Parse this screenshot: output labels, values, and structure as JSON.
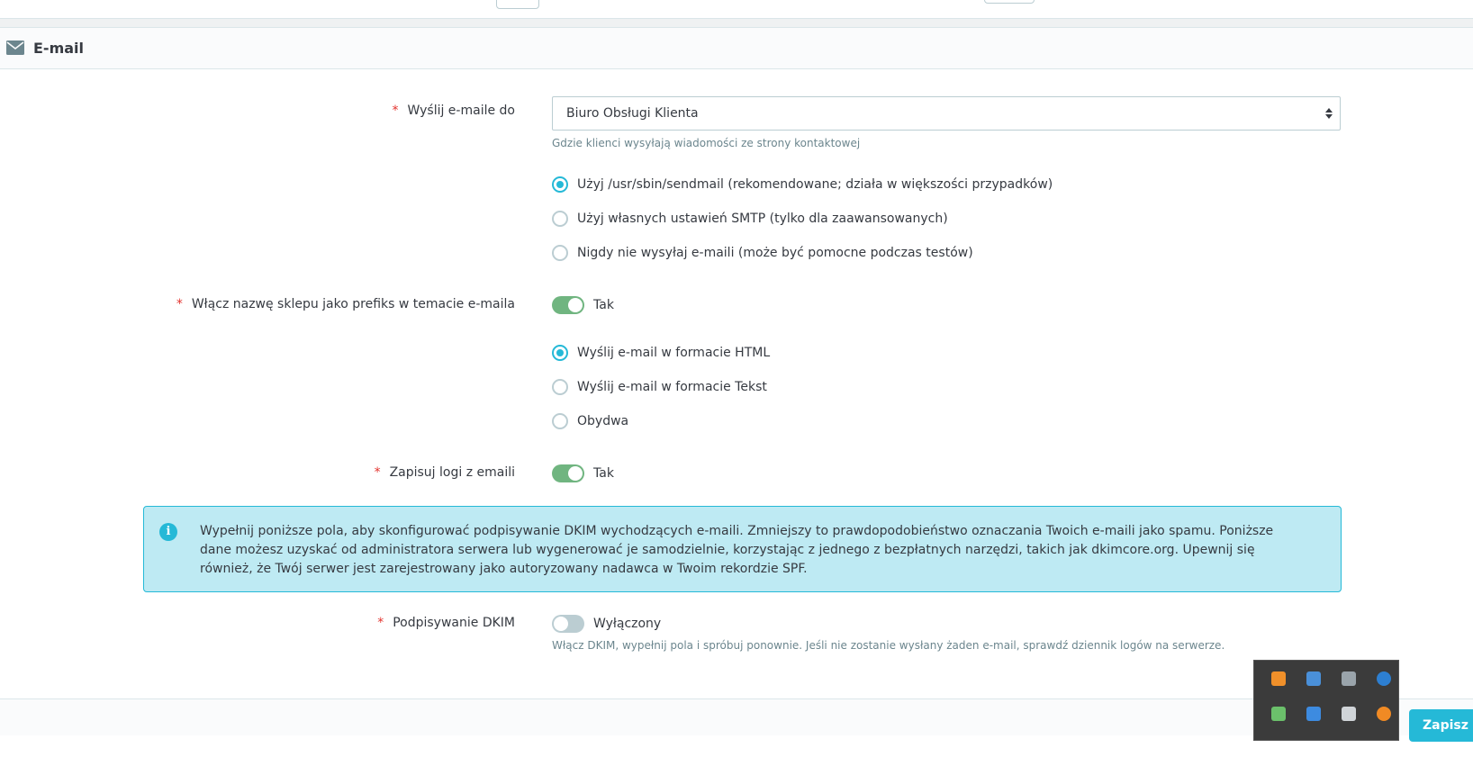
{
  "panel": {
    "title": "E-mail",
    "icon": "envelope-icon"
  },
  "fields": {
    "send_to": {
      "label": "Wyślij e-maile do",
      "required_mark": "*",
      "selected_value": "Biuro Obsługi Klienta",
      "help": "Gdzie klienci wysyłają wiadomości ze strony kontaktowej"
    },
    "mail_method": {
      "options": [
        {
          "label": "Użyj /usr/sbin/sendmail (rekomendowane; działa w większości przypadków)",
          "checked": true
        },
        {
          "label": "Użyj własnych ustawień SMTP (tylko dla zaawansowanych)",
          "checked": false
        },
        {
          "label": "Nigdy nie wysyłaj e-maili (może być pomocne podczas testów)",
          "checked": false
        }
      ]
    },
    "shop_prefix": {
      "label": "Włącz nazwę sklepu jako prefiks w temacie e-maila",
      "required_mark": "*",
      "state": "Tak",
      "enabled": true
    },
    "mail_format": {
      "options": [
        {
          "label": "Wyślij e-mail w formacie HTML",
          "checked": true
        },
        {
          "label": "Wyślij e-mail w formacie Tekst",
          "checked": false
        },
        {
          "label": "Obydwa",
          "checked": false
        }
      ]
    },
    "log_emails": {
      "label": "Zapisuj logi z emaili",
      "required_mark": "*",
      "state": "Tak",
      "enabled": true
    },
    "dkim_info": "Wypełnij poniższe pola, aby skonfigurować podpisywanie DKIM wychodzących e-maili. Zmniejszy to prawdopodobieństwo oznaczania Twoich e-maili jako spamu. Poniższe dane możesz uzyskać od administratora serwera lub wygenerować je samodzielnie, korzystając z jednego z bezpłatnych narzędzi, takich jak dkimcore.org. Upewnij się również, że Twój serwer jest zarejestrowany jako autoryzowany nadawca w Twoim rekordzie SPF.",
    "dkim": {
      "label": "Podpisywanie DKIM",
      "required_mark": "*",
      "state": "Wyłączony",
      "enabled": false,
      "help": "Włącz DKIM, wypełnij pola i spróbuj ponownie. Jeśli nie zostanie wysłany żaden e-mail, sprawdź dziennik logów na serwerze."
    }
  },
  "footer": {
    "save_label": "Zapisz"
  },
  "tray": {
    "icons": [
      "orange-box-icon",
      "monitor-icon",
      "keyboard-mouse-icon",
      "globe-icon",
      "network-icon",
      "document-icon",
      "book-icon",
      "orange-circle-icon"
    ]
  },
  "colors": {
    "accent": "#25b9d7",
    "switch_on": "#70b580",
    "required": "#e3342f",
    "alert_bg": "#beeaf3"
  }
}
